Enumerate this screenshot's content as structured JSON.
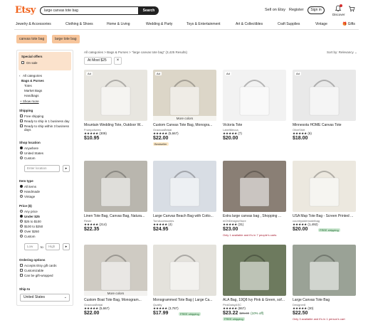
{
  "header": {
    "logo": "Etsy",
    "search_value": "large canvas tote bag",
    "search_button": "Search",
    "sell": "Sell on Etsy",
    "register": "Register",
    "signin": "Sign in",
    "discover": "Discover"
  },
  "nav": [
    "Jewelry & Accessories",
    "Clothing & Shoes",
    "Home & Living",
    "Wedding & Party",
    "Toys & Entertainment",
    "Art & Collectibles",
    "Craft Supplies",
    "Vintage",
    "Gifts"
  ],
  "chips": [
    "canvas tote bag",
    "large tote bag"
  ],
  "sidebar": {
    "special_offers": "Special offers",
    "on_sale": "On sale",
    "all_categories": "All categories",
    "bags_purses": "Bags & Purses",
    "totes": "Totes",
    "market_bags": "Market Bags",
    "handbags": "Handbags",
    "show_more": "+ Show more",
    "shipping": "Shipping",
    "free_shipping": "Free shipping",
    "ready_1": "Ready to ship in 1 business day",
    "ready_3": "Ready to ship within 3 business days",
    "shop_location": "Shop location",
    "anywhere": "Anywhere",
    "united_states": "United States",
    "custom": "Custom",
    "enter_location": "Enter location",
    "item_type": "Item type",
    "all_items": "All items",
    "handmade": "Handmade",
    "vintage": "Vintage",
    "price": "Price ($)",
    "any_price": "Any price",
    "under_25": "Under $25",
    "p25_100": "$25 to $100",
    "p100_250": "$100 to $250",
    "over_250": "Over $250",
    "custom_price": "Custom",
    "low": "Low",
    "to": "to",
    "high": "High",
    "ordering": "Ordering options",
    "accepts_gift": "Accepts Etsy gift cards",
    "customizable": "Customizable",
    "gift_wrapped": "Can be gift-wrapped",
    "ship_to": "Ship to",
    "ship_to_value": "United States"
  },
  "results": {
    "breadcrumb": "All categories > Bags & Purses > \"large canvas tote bag\" (3,425 Results)",
    "sort": "Sort by: Relevancy",
    "filter": "At Most $25",
    "clear": "×"
  },
  "products": [
    {
      "ad": "Ad",
      "title": "Mountain Wedding Tote, Outdoor W...",
      "shop": "Frumpofuries",
      "rating": "★★★★★ (309)",
      "price": "$10.95",
      "thumb_color": "#e8e6e0"
    },
    {
      "ad": "Ad",
      "more_colors": "More colors",
      "title": "Custom Canvas Tote Bag, Monogra...",
      "shop": "GraciousBridal",
      "rating": "★★★★★ (5,667)",
      "price": "$22.00",
      "badge": "Bestseller",
      "thumb_color": "#dcd6c8"
    },
    {
      "ad": "Ad",
      "title": "Victoria Tote",
      "shop": "LabelMecca",
      "rating": "★★★★★ (7)",
      "price": "$20.00",
      "thumb_color": "#f2f2f2"
    },
    {
      "ad": "Ad",
      "title": "Minnesota HOME Canvas Tote",
      "shop": "OliveShirt",
      "rating": "★★★★★ (6)",
      "price": "$18.00",
      "thumb_color": "#e9e9e9"
    },
    {
      "title": "Linen Tote Bag, Canvas Bag, Natura...",
      "shop": "Reste",
      "rating": "★★★★★ (214)",
      "price": "$22.35",
      "thumb_color": "#b9b6ae"
    },
    {
      "title": "Large Canvas Beach Bag with Cotto...",
      "shop": "TornAccessories",
      "rating": "★★★★★ (4)",
      "price": "$24.95",
      "thumb_color": "#d8dde4"
    },
    {
      "title": "Extra large canvas bag , Shopping ...",
      "shop": "mOhDesignsStore",
      "rating": "★★★★★ (31)",
      "price": "$23.00",
      "note": "Only 1 available and it's in 7 people's carts",
      "thumb_color": "#8a7f75"
    },
    {
      "title": "USA Map Tote Bag - Screen Printed ...",
      "shop": "countrysidemodelbag",
      "rating": "★★★★★ (1,492)",
      "price": "$20.00",
      "shipping": "FREE shipping",
      "thumb_color": "#ece8df"
    },
    {
      "more_colors": "More colors",
      "title": "Custom Boat Tote Bag, Monogram...",
      "shop": "GraciousBridal",
      "rating": "★★★★★ (5,667)",
      "price": "$22.00",
      "thumb_color": "#cfcbc3"
    },
    {
      "title": "Monogrammed Tote Bag | Large Ca...",
      "shop": "Quality",
      "rating": "★★★★★ (3,787)",
      "price": "$17.99",
      "shipping": "FREE shipping",
      "thumb_color": "#e4e2dc"
    },
    {
      "title": "ALA Bag, 19Q8 Ivy Pink & Green, sof...",
      "shop": "PinkDaisyASC",
      "rating": "★★★★★ (867)",
      "price": "$23.22",
      "old_price": "$25.80",
      "discount": "(10% off)",
      "shipping": "FREE shipping",
      "thumb_color": "#6d7a5e"
    },
    {
      "title": "Large Canvas Tote Bag",
      "shop": "Designer8",
      "rating": "★★★★★ (30)",
      "price": "$22.50",
      "note": "Only 3 available and it's in 1 person's cart",
      "thumb_color": "#9aa296"
    }
  ],
  "colors": {
    "accent": "#f1641e",
    "chip": "#f7c59b",
    "offers": "#fbe2cc",
    "ship_green": "#cde8d2"
  }
}
